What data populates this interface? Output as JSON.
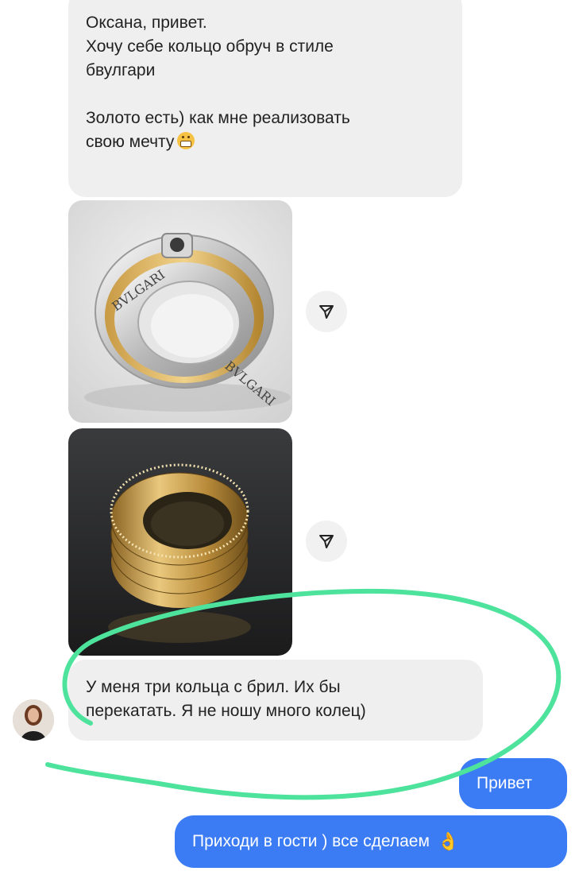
{
  "chat": {
    "incoming": [
      {
        "line1": "Оксана, привет.",
        "line2": "Хочу себе кольцо обруч в стиле",
        "line3": "бвулгари",
        "line4": "Золото есть) как мне реализовать",
        "line5": "свою мечту",
        "emoji": "grimacing-emoji"
      },
      {
        "line1": "У меня три кольца с брил. Их бы",
        "line2": "перекатать. Я не ношу много колец)"
      }
    ],
    "photos": [
      {
        "ring_engraving": "BVLGARI"
      },
      {
        "ring_engraving": ""
      }
    ],
    "outgoing": [
      {
        "text": "Привет"
      },
      {
        "text": "Приходи в гости ) все сделаем",
        "emoji": "ok-hand-emoji"
      }
    ]
  },
  "colors": {
    "incoming_bubble": "#efefef",
    "outgoing_bubble": "#3b7cf5",
    "annotation_stroke": "#4ee39c"
  },
  "icons": {
    "share": "paper-plane-icon"
  }
}
